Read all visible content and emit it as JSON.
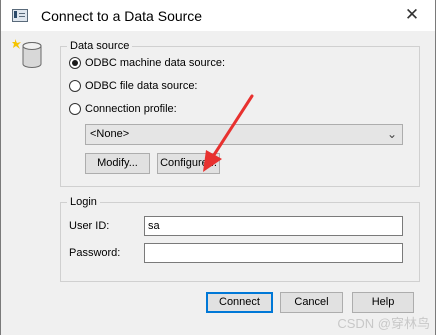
{
  "window": {
    "title": "Connect to a Data Source",
    "close_glyph": "✕"
  },
  "data_source": {
    "legend": "Data source",
    "options": [
      {
        "label": "ODBC machine data source:",
        "selected": true
      },
      {
        "label": "ODBC file data source:",
        "selected": false
      },
      {
        "label": "Connection profile:",
        "selected": false
      }
    ],
    "profile_value": "<None>",
    "modify_label": "Modify...",
    "configure_label": "Configure..."
  },
  "login": {
    "legend": "Login",
    "user_id_label": "User ID:",
    "user_id_value": "sa",
    "password_label": "Password:",
    "password_value": ""
  },
  "buttons": {
    "connect": "Connect",
    "cancel": "Cancel",
    "help": "Help"
  },
  "watermark": "CSDN @穿林鸟",
  "colors": {
    "annotation_arrow": "#e8312f",
    "default_button_border": "#0078d7"
  }
}
